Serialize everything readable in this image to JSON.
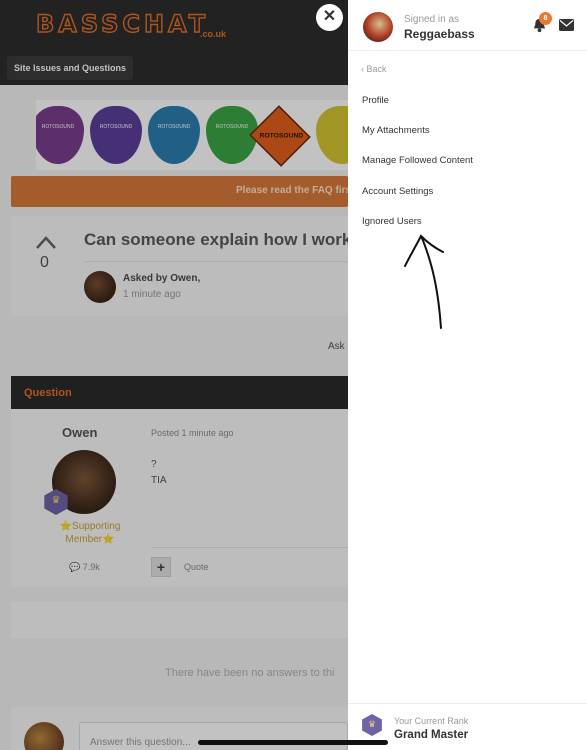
{
  "site": {
    "logo_text": "BASSCHAT",
    "logo_suffix": ".co.uk",
    "breadcrumb": "Site Issues and Questions"
  },
  "banner": {
    "pick_text": "ROTOSOUND",
    "brand_text": "ROTOSOUND"
  },
  "faq_text": "Please read the FAQ first",
  "question": {
    "votes": "0",
    "title": "Can someone explain how I work",
    "asked_by": "Asked by Owen,",
    "time": "1 minute ago",
    "ask_partial": "Ask"
  },
  "post": {
    "section_label": "Question",
    "author": "Owen",
    "supporting": "⭐️Supporting Member⭐️",
    "post_count": "7.9k",
    "posted": "Posted 1 minute ago",
    "body_line1": "?",
    "body_line2": "TIA",
    "quote_label": "Quote",
    "plus_label": "+"
  },
  "answers": {
    "empty_text": "There have been no answers to thi",
    "answer_placeholder": "Answer this question..."
  },
  "drawer": {
    "signed_in_label": "Signed in as",
    "username": "Reggaebass",
    "notification_count": "8",
    "back_label": "Back",
    "menu": [
      {
        "label": "Profile"
      },
      {
        "label": "My Attachments"
      },
      {
        "label": "Manage Followed Content"
      },
      {
        "label": "Account Settings"
      },
      {
        "label": "Ignored Users"
      }
    ],
    "rank_label": "Your Current Rank",
    "rank_name": "Grand Master"
  },
  "colors": {
    "accent": "#e5702a",
    "header_bg": "#2d2d2d",
    "badge": "#ea7a2e",
    "rank": "#6f63a8"
  }
}
